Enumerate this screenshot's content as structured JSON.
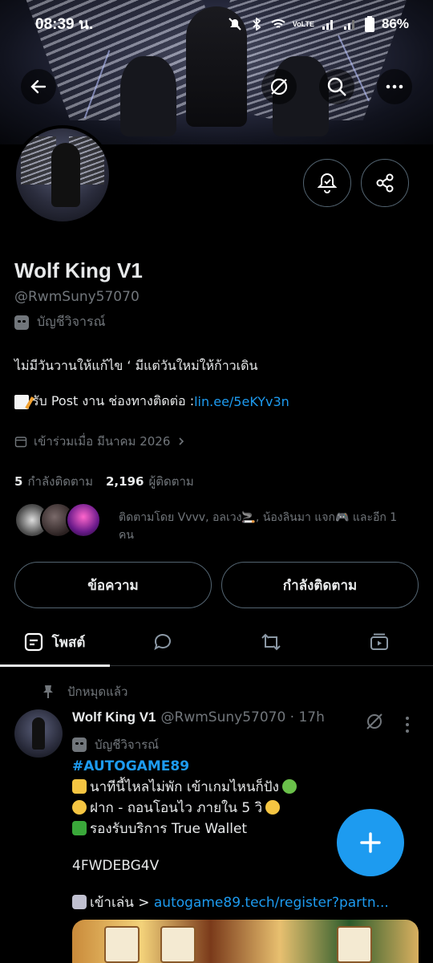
{
  "status_bar": {
    "time": "08:39 น.",
    "battery": "86%",
    "network": "VoLTE"
  },
  "profile": {
    "display_name": "Wolf King V1",
    "handle": "@RwmSuny57070",
    "account_label": "บัญชีวิจารณ์",
    "bio_line1": "ไม่มีวันวานให้แก้ไข ‘ มีแต่วันใหม่ให้ก้าวเดิน",
    "bio_line2_prefix": "รับ Post งาน ช่องทางติดต่อ : ",
    "bio_link": "lin.ee/5eKYv3n",
    "joined": "เข้าร่วมเมื่อ มีนาคม 2026",
    "following_count": "5",
    "following_label": "กำลังติดตาม",
    "followers_count": "2,196",
    "followers_label": "ผู้ติดตาม",
    "followed_by_text": "ติดตามโดย Vvvv, อลเวง🚬, น้องลินมา แจก🎮 และอีก 1 คน"
  },
  "actions": {
    "message_label": "ข้อความ",
    "following_label": "กำลังติดตาม"
  },
  "tabs": [
    {
      "label": "โพสต์",
      "icon": "post-icon"
    },
    {
      "label": "",
      "icon": "reply-icon"
    },
    {
      "label": "",
      "icon": "repost-icon"
    },
    {
      "label": "",
      "icon": "media-icon"
    }
  ],
  "pinned_post": {
    "pinned_label": "ปักหมุดแล้ว",
    "author_name": "Wolf King V1",
    "author_handle": "@RwmSuny57070 · 17h",
    "account_label": "บัญชีวิจารณ์",
    "hashtag": "#AUTOGAME89",
    "line1": "นาทีนี้ไหลไม่พัก เข้าเกมไหนก็ปัง",
    "line2": "ฝาก - ถอนโอนไว ภายใน 5 วิ",
    "line3": "รองรับบริการ True Wallet",
    "code": "4FWDEBG4V",
    "play_prefix": "เข้าเล่น > ",
    "play_link": "autogame89.tech/register?partn..."
  },
  "colors": {
    "accent": "#1d9bf0",
    "background": "#000000",
    "text_primary": "#e7e9ea",
    "text_secondary": "#71767b",
    "border": "#536471"
  }
}
